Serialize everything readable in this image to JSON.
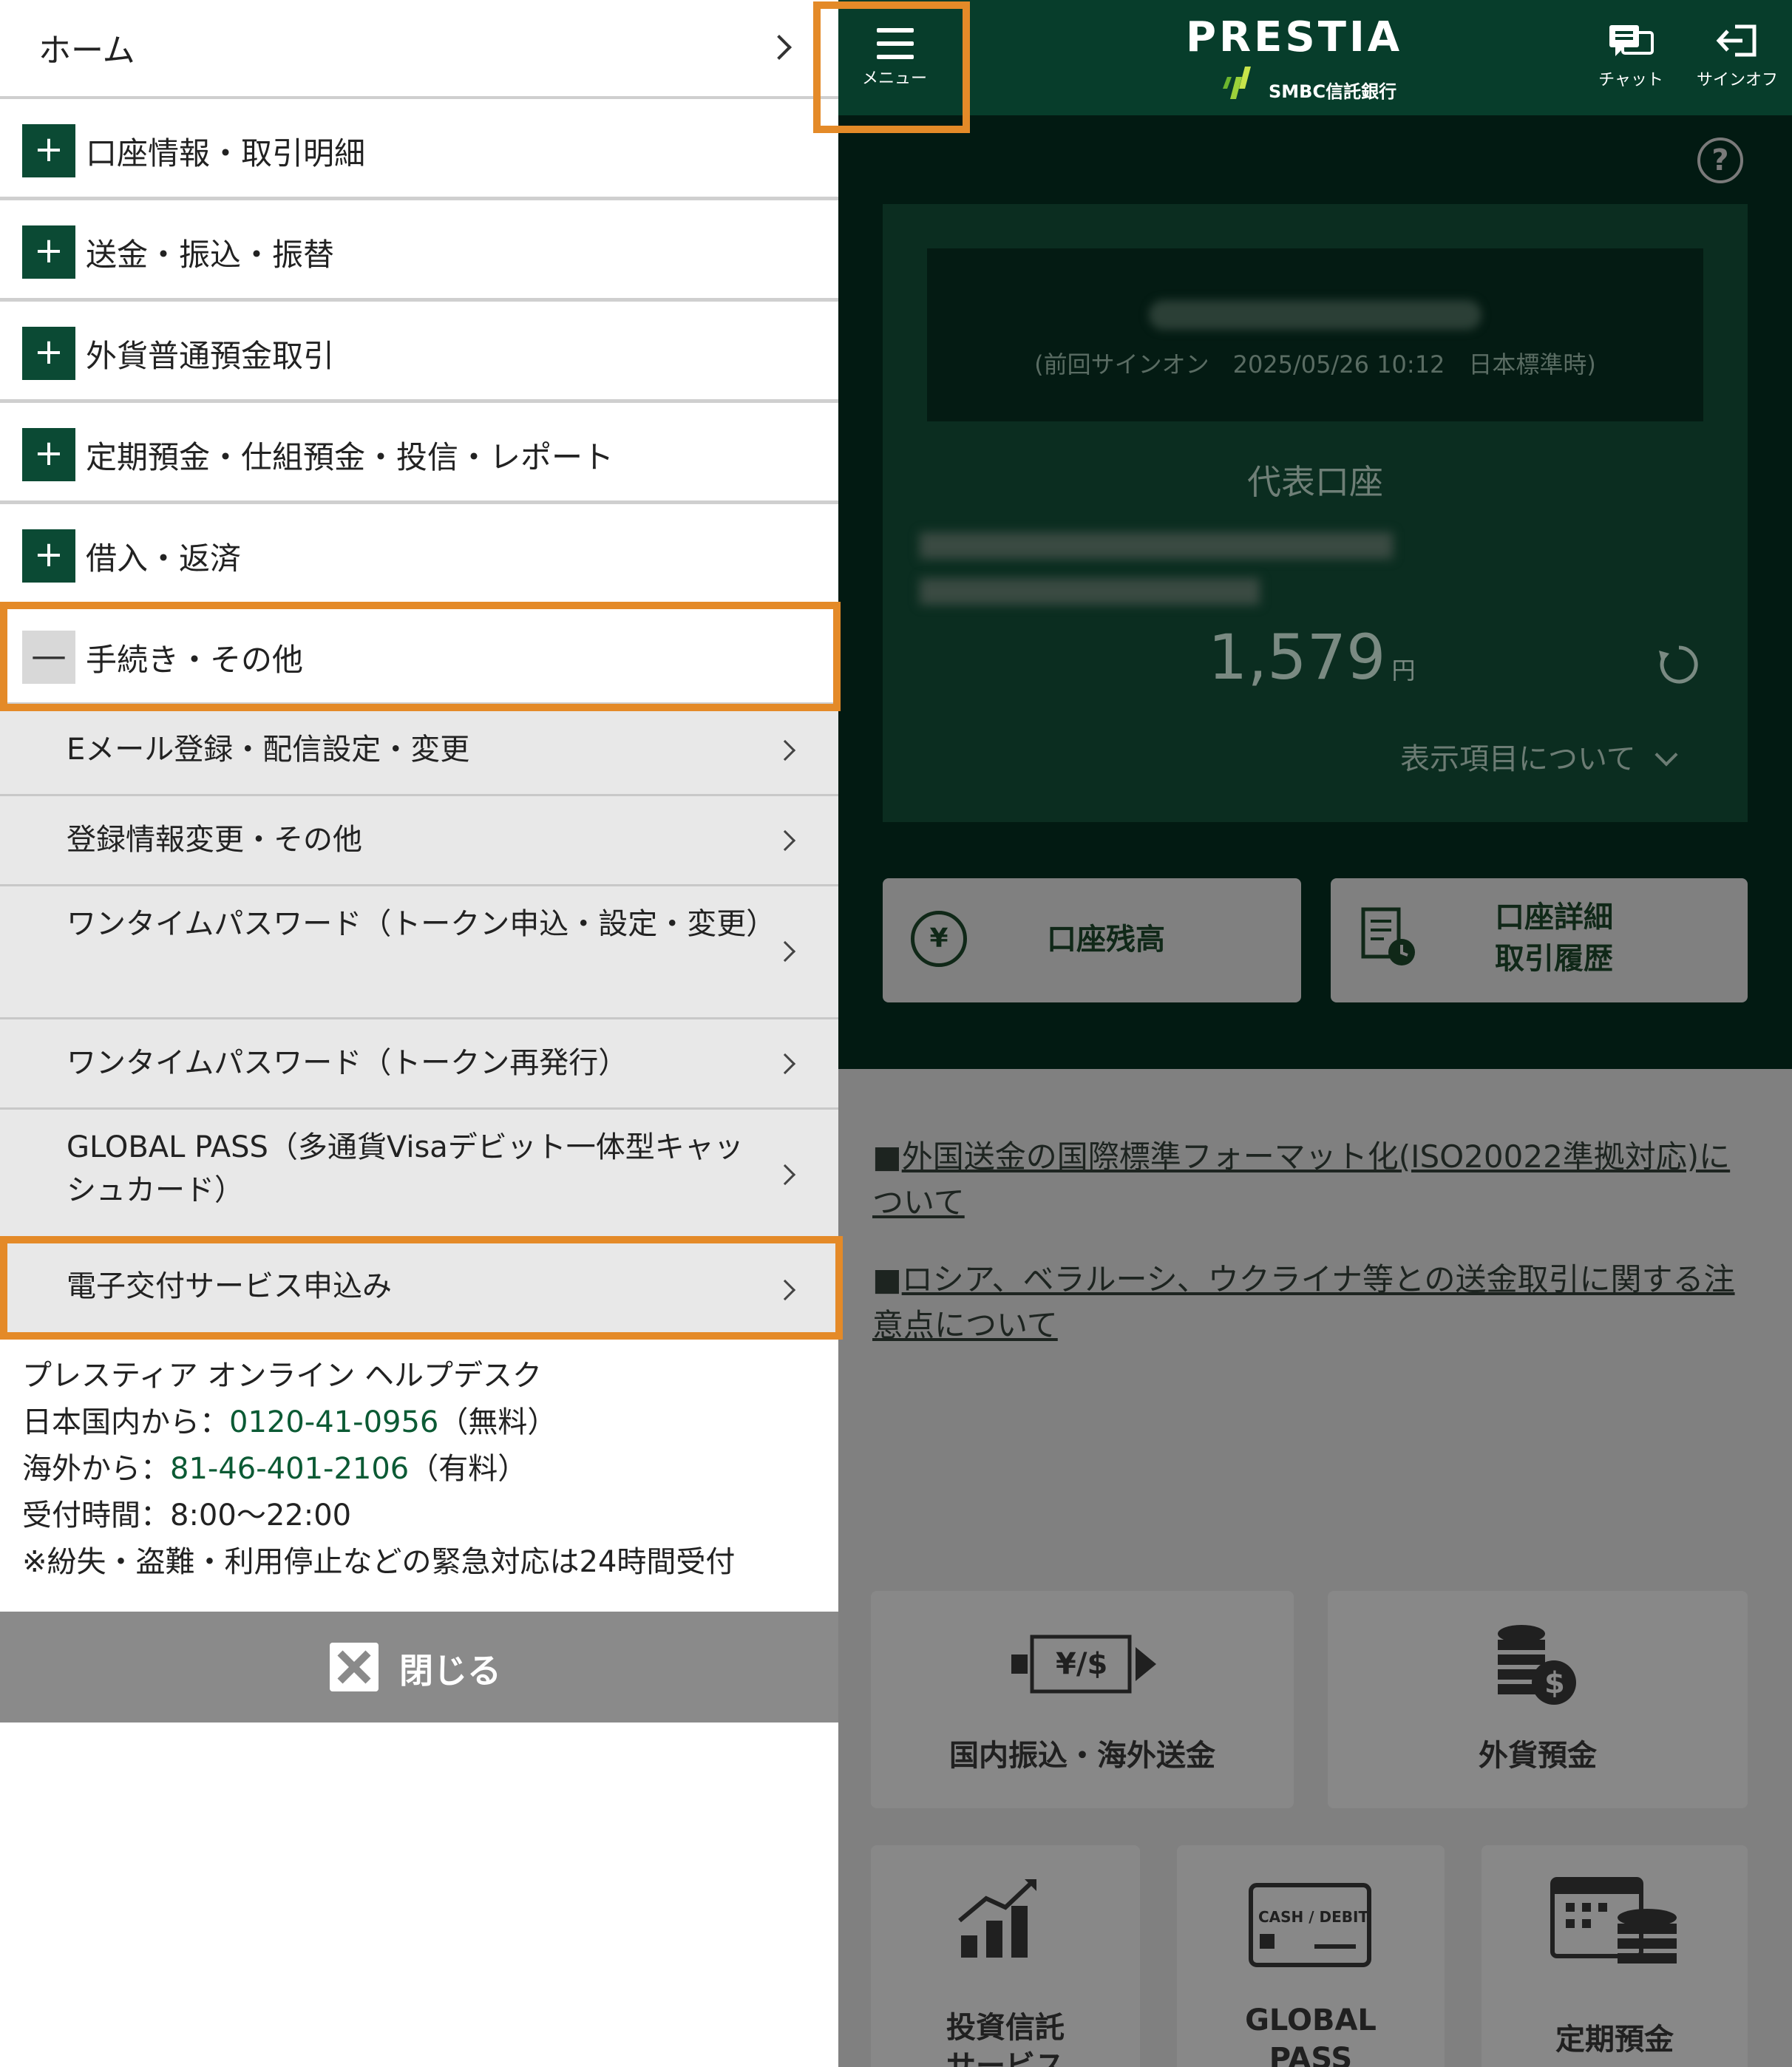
{
  "header": {
    "menu_label": "メニュー",
    "logo_text": "PRESTIA",
    "logo_sub": "SMBC信託銀行",
    "chat_label": "チャット",
    "signoff_label": "サインオフ"
  },
  "account": {
    "signin_info": "(前回サインオン　2025/05/26 10:12　日本標準時)",
    "rep_label": "代表口座",
    "balance": "1,579",
    "currency": "円",
    "display_about": "表示項目について"
  },
  "quick": {
    "balance_label": "口座残高",
    "detail_line1": "口座詳細",
    "detail_line2": "取引履歴"
  },
  "notices": [
    {
      "bullet": "■",
      "text": "外国送金の国際標準フォーマット化(ISO20022準拠対応)について"
    },
    {
      "bullet": "■",
      "text": "ロシア、ベラルーシ、ウクライナ等との送金取引に関する注意点について"
    }
  ],
  "tiles": {
    "transfer": "国内振込・海外送金",
    "fx": "外貨預金",
    "invest_line1": "投資信託",
    "invest_line2": "サービス",
    "global_line1": "GLOBAL",
    "global_line2": "PASS",
    "time_deposit": "定期預金",
    "card_text": "CASH / DEBIT"
  },
  "menu": {
    "home": "ホーム",
    "categories": [
      {
        "label": "口座情報・取引明細",
        "icon": "+"
      },
      {
        "label": "送金・振込・振替",
        "icon": "+"
      },
      {
        "label": "外貨普通預金取引",
        "icon": "+"
      },
      {
        "label": "定期預金・仕組預金・投信・レポート",
        "icon": "+"
      },
      {
        "label": "借入・返済",
        "icon": "+"
      },
      {
        "label": "手続き・その他",
        "icon": "—"
      }
    ],
    "sub_items": [
      {
        "label": "Eメール登録・配信設定・変更"
      },
      {
        "label": "登録情報変更・その他"
      },
      {
        "label": "ワンタイムパスワード（トークン申込・設定・変更）"
      },
      {
        "label": "ワンタイムパスワード（トークン再発行）"
      },
      {
        "label": "GLOBAL PASS（多通貨Visaデビット一体型キャッシュカード）"
      },
      {
        "label": "電子交付サービス申込み"
      }
    ]
  },
  "help": {
    "title": "プレスティア オンライン ヘルプデスク",
    "domestic_prefix": "日本国内から：",
    "domestic_tel": "0120-41-0956",
    "domestic_suffix": "（無料）",
    "overseas_prefix": "海外から：",
    "overseas_tel": "81-46-401-2106",
    "overseas_suffix": "（有料）",
    "hours": "受付時間：8:00～22:00",
    "note": "※紛失・盗難・利用停止などの緊急対応は24時間受付"
  },
  "close_label": "閉じる",
  "colors": {
    "brand_green": "#073d2b",
    "highlight": "#e48a28",
    "menu_plus": "#0b4a34"
  }
}
